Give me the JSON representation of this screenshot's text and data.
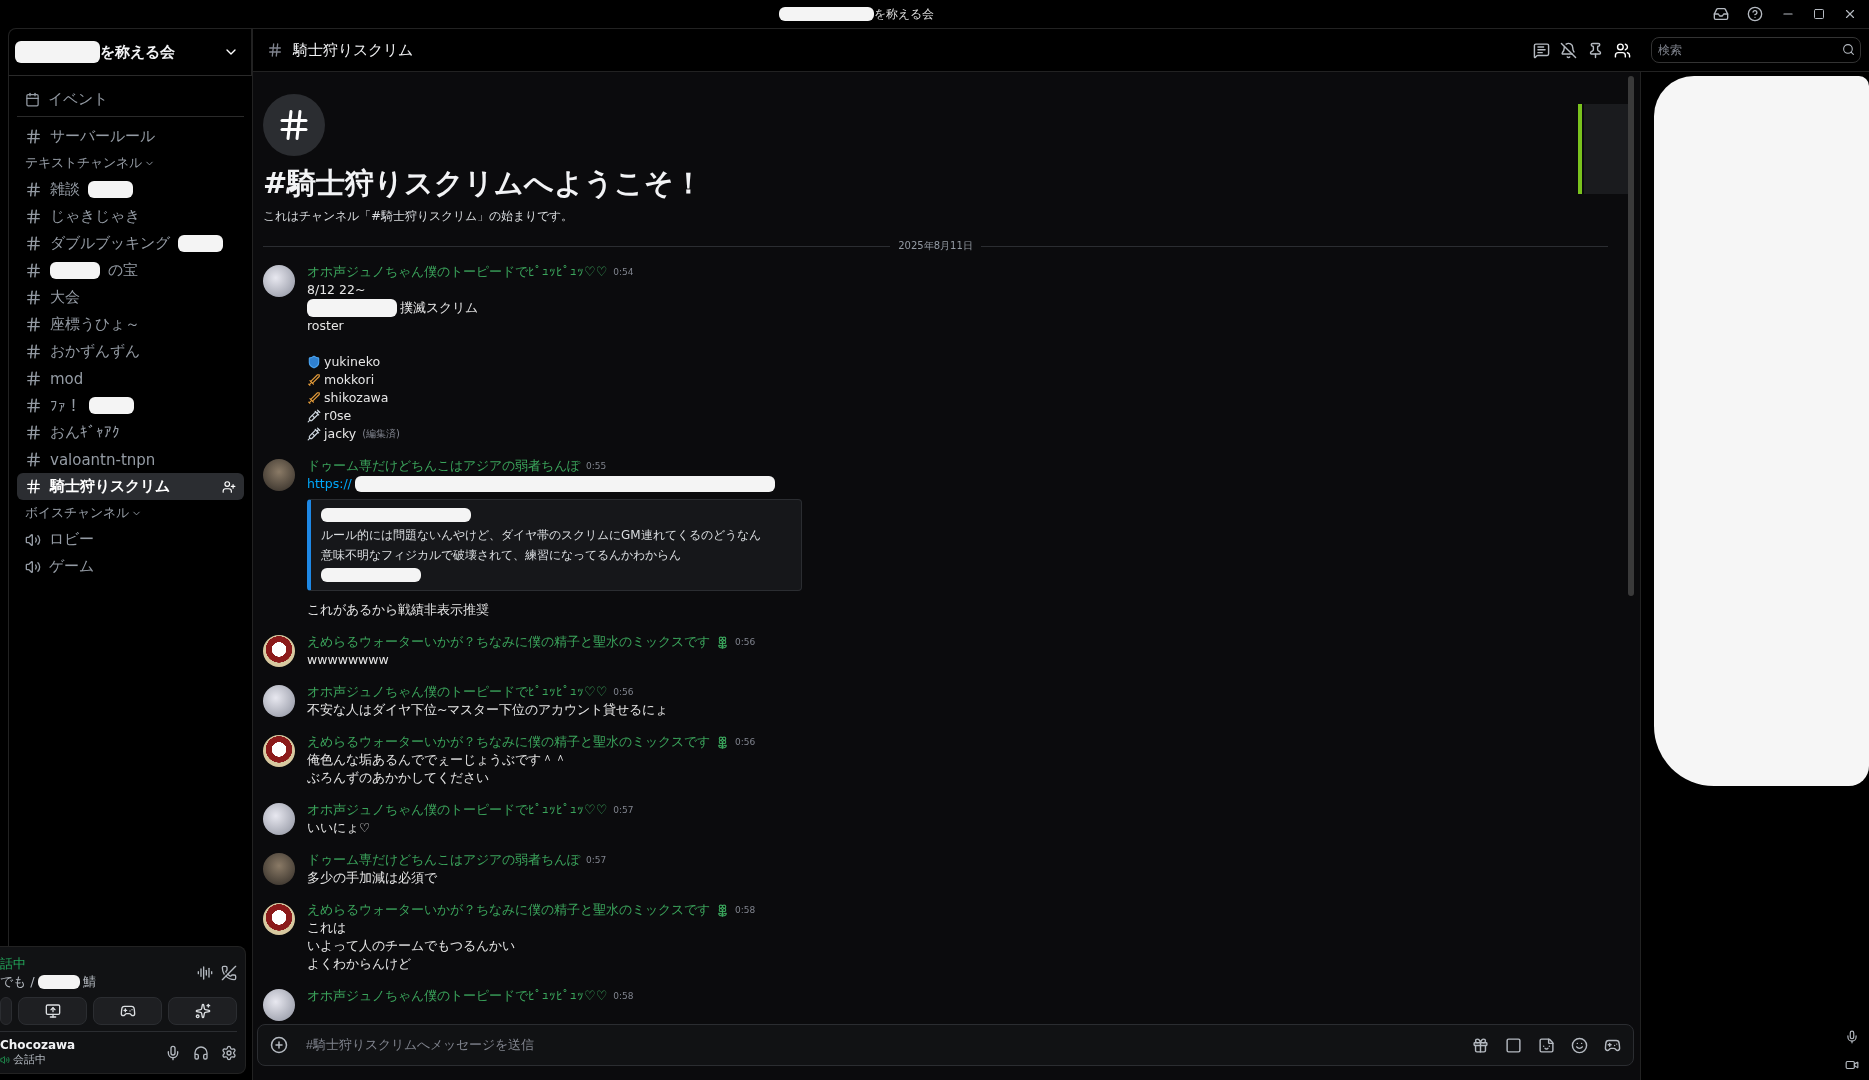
{
  "title_bar": {
    "title": "を称える会"
  },
  "server": {
    "name": "を称える会"
  },
  "sidebar": {
    "events": "イベント",
    "channels": [
      {
        "kind": "text",
        "name": "サーバールール",
        "mask_before": false,
        "mask_after": false,
        "selected": false
      },
      {
        "kind": "category",
        "name": "テキストチャンネル"
      },
      {
        "kind": "text",
        "name": "雑談",
        "mask_before": false,
        "mask_after": true,
        "selected": false
      },
      {
        "kind": "text",
        "name": "じゃきじゃき",
        "mask_before": false,
        "mask_after": false,
        "selected": false
      },
      {
        "kind": "text",
        "name": "ダブルブッキング",
        "mask_before": false,
        "mask_after": true,
        "selected": false
      },
      {
        "kind": "text",
        "name": "の宝",
        "mask_before": true,
        "mask_after": false,
        "selected": false
      },
      {
        "kind": "text",
        "name": "大会",
        "mask_before": false,
        "mask_after": false,
        "selected": false
      },
      {
        "kind": "text",
        "name": "座標うひょ～",
        "mask_before": false,
        "mask_after": false,
        "selected": false
      },
      {
        "kind": "text",
        "name": "おかずんずん",
        "mask_before": false,
        "mask_after": false,
        "selected": false
      },
      {
        "kind": "text",
        "name": "mod",
        "mask_before": false,
        "mask_after": false,
        "selected": false
      },
      {
        "kind": "text",
        "name": "ﾌｧ！",
        "mask_before": false,
        "mask_after": true,
        "selected": false
      },
      {
        "kind": "text",
        "name": "おんｷﾞｬｱｸ",
        "mask_before": false,
        "mask_after": false,
        "selected": false
      },
      {
        "kind": "text",
        "name": "valoantn-tnpn",
        "mask_before": false,
        "mask_after": false,
        "selected": false
      },
      {
        "kind": "text",
        "name": "騎士狩りスクリム",
        "mask_before": false,
        "mask_after": false,
        "selected": true
      },
      {
        "kind": "category",
        "name": "ボイスチャンネル"
      },
      {
        "kind": "voice",
        "name": "ロビー",
        "mask_before": false,
        "mask_after": false,
        "selected": false
      },
      {
        "kind": "voice",
        "name": "ゲーム",
        "mask_before": false,
        "mask_after": false,
        "selected": false
      }
    ]
  },
  "voice_panel": {
    "status": "話中",
    "channel_before": "でも /",
    "channel_after": "鯖"
  },
  "user_panel": {
    "name": "Chocozawa",
    "status": "会話中"
  },
  "channel_header": {
    "name": "騎士狩りスクリム",
    "search_placeholder": "検索"
  },
  "welcome": {
    "title": "#騎士狩りスクリムへようこそ！",
    "subtitle": "これはチャンネル「#騎士狩りスクリム」の始まりです。"
  },
  "date_divider": "2025年8月11日",
  "messages": [
    {
      "author": "オホ声ジュノちゃん僕のトーピードでﾋﾟｭｯﾋﾟｭｯ♡♡",
      "time": "0:54",
      "kind": "portrait",
      "role_icon": false,
      "content": [
        {
          "kind": "text",
          "text": "8/12 22~"
        },
        {
          "kind": "maskedtext",
          "text": "撲滅スクリム"
        },
        {
          "kind": "text",
          "text": "roster"
        },
        {
          "kind": "blank"
        },
        {
          "kind": "shield",
          "text": "yukineko"
        },
        {
          "kind": "sword",
          "text": "mokkori"
        },
        {
          "kind": "sword",
          "text": "shikozawa"
        },
        {
          "kind": "syringe",
          "text": "r0se"
        },
        {
          "kind": "syringe",
          "text": "jacky",
          "edited": "(編集済)"
        }
      ]
    },
    {
      "author": "ドゥーム専だけどちんこはアジアの弱者ちんぽ",
      "time": "0:55",
      "kind": "cat",
      "role_icon": false,
      "content": [
        {
          "kind": "link",
          "text": "https://"
        },
        {
          "kind": "embed",
          "lines": [
            "ルール的には問題ないんやけど、ダイヤ帯のスクリムにGM連れてくるのどうなん",
            "意味不明なフィジカルで破壊されて、練習になってるんかわからん"
          ]
        },
        {
          "kind": "text",
          "text": "これがあるから戦績非表示推奨"
        }
      ]
    },
    {
      "author": "えめらるウォーターいかが？ちなみに僕の精子と聖水のミックスです",
      "time": "0:56",
      "kind": "frog",
      "role_icon": true,
      "content": [
        {
          "kind": "text",
          "text": "wwwwwwww"
        }
      ]
    },
    {
      "author": "オホ声ジュノちゃん僕のトーピードでﾋﾟｭｯﾋﾟｭｯ♡♡",
      "time": "0:56",
      "kind": "portrait",
      "role_icon": false,
      "content": [
        {
          "kind": "text",
          "text": "不安な人はダイヤ下位~マスター下位のアカウント貸せるにょ"
        }
      ]
    },
    {
      "author": "えめらるウォーターいかが？ちなみに僕の精子と聖水のミックスです",
      "time": "0:56",
      "kind": "frog",
      "role_icon": true,
      "content": [
        {
          "kind": "text",
          "text": "俺色んな垢あるんででぇーじょうぶです＾＾"
        },
        {
          "kind": "text",
          "text": "ぶろんずのあかかしてください"
        }
      ]
    },
    {
      "author": "オホ声ジュノちゃん僕のトーピードでﾋﾟｭｯﾋﾟｭｯ♡♡",
      "time": "0:57",
      "kind": "portrait",
      "role_icon": false,
      "content": [
        {
          "kind": "text",
          "text": "いいにょ♡"
        }
      ]
    },
    {
      "author": "ドゥーム専だけどちんこはアジアの弱者ちんぽ",
      "time": "0:57",
      "kind": "cat",
      "role_icon": false,
      "content": [
        {
          "kind": "text",
          "text": "多少の手加減は必須で"
        }
      ]
    },
    {
      "author": "えめらるウォーターいかが？ちなみに僕の精子と聖水のミックスです",
      "time": "0:58",
      "kind": "frog",
      "role_icon": true,
      "content": [
        {
          "kind": "text",
          "text": "これは"
        },
        {
          "kind": "text",
          "text": "いよって人のチームでもつるんかい"
        },
        {
          "kind": "text",
          "text": "よくわからんけど"
        }
      ]
    },
    {
      "author": "オホ声ジュノちゃん僕のトーピードでﾋﾟｭｯﾋﾟｭｯ♡♡",
      "time": "0:58",
      "kind": "portrait",
      "role_icon": false
    }
  ],
  "composer": {
    "placeholder": "#騎士狩りスクリムへメッセージを送信"
  }
}
